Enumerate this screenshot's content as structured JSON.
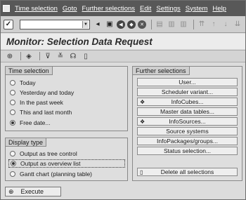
{
  "menu": [
    "Time selection",
    "Goto",
    "Further selections",
    "Edit",
    "Settings",
    "System",
    "Help"
  ],
  "title": "Monitor: Selection Data Request",
  "time_selection": {
    "label": "Time selection",
    "options": [
      "Today",
      "Yesterday and today",
      "In the past week",
      "This and last month",
      "Free date..."
    ],
    "selected": "Free date..."
  },
  "display_type": {
    "label": "Display type",
    "options": [
      "Output as tree control",
      "Output as overview list",
      "Gantt chart (planning table)"
    ],
    "selected": "Output as overview list"
  },
  "further_selections": {
    "label": "Further selections",
    "buttons": [
      "User...",
      "Scheduler variant...",
      "InfoCubes...",
      "Master data tables...",
      "InfoSources...",
      "Source systems",
      "InfoPackages/groups...",
      "Status selection..."
    ],
    "delete_label": "Delete all selections"
  },
  "execute_label": "Execute"
}
